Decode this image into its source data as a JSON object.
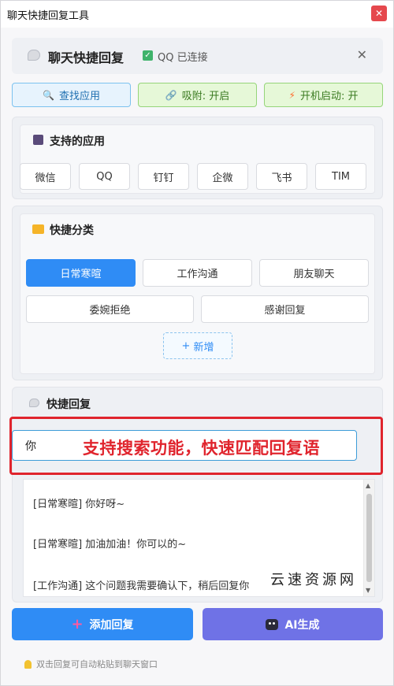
{
  "window": {
    "title": "聊天快捷回复工具",
    "close_glyph": "✕"
  },
  "header": {
    "title": "聊天快捷回复",
    "connection": "QQ 已连接",
    "close_glyph": "✕"
  },
  "toolbar": {
    "find": "查找应用",
    "snap": "吸附: 开启",
    "boot": "开机启动: 开"
  },
  "apps": {
    "title": "支持的应用",
    "items": [
      "微信",
      "QQ",
      "钉钉",
      "企微",
      "飞书",
      "TIM"
    ]
  },
  "categories": {
    "title": "快捷分类",
    "items": [
      "日常寒暄",
      "工作沟通",
      "朋友聊天",
      "委婉拒绝",
      "感谢回复"
    ],
    "active": "日常寒暄",
    "add_label": "新增",
    "add_glyph": "+"
  },
  "quick": {
    "title": "快捷回复",
    "search_value": "你",
    "annotation": "支持搜索功能，快速匹配回复语",
    "items": [
      "[日常寒暄] 你好呀~",
      "[日常寒暄] 加油加油！你可以的~",
      "[工作沟通] 这个问题我需要确认下，稍后回复你"
    ]
  },
  "watermark": "云速资源网",
  "actions": {
    "add": "添加回复",
    "ai": "AI生成"
  },
  "footer": {
    "tip": "双击回复可自动粘贴到聊天窗口"
  },
  "colors": {
    "primary": "#2f8cf5",
    "ai": "#6f72e6",
    "annotation": "#e0242d",
    "connected": "#3fb36b"
  }
}
